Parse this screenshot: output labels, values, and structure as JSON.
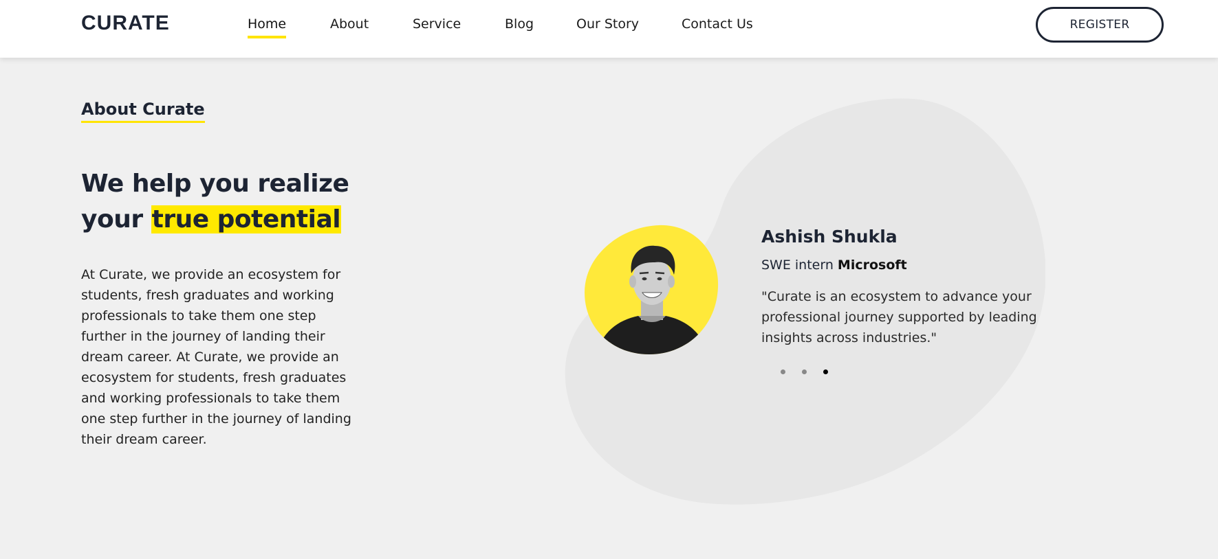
{
  "header": {
    "logo": "CURATE",
    "nav": [
      {
        "label": "Home",
        "active": true
      },
      {
        "label": "About"
      },
      {
        "label": "Service"
      },
      {
        "label": "Blog"
      },
      {
        "label": "Our Story"
      },
      {
        "label": "Contact Us"
      }
    ],
    "register_label": "REGISTER"
  },
  "about": {
    "section_label": "About Curate",
    "headline_line1": "We help you realize",
    "headline_prefix": "your ",
    "headline_highlight": "true potential",
    "body": "At Curate, we provide an ecosystem for students, fresh graduates and working professionals to take them one step further in the journey of landing their dream career. At Curate, we provide an ecosystem for students, fresh graduates and working professionals to take them one step further in the journey of landing their dream career."
  },
  "testimonial": {
    "name": "Ashish Shukla",
    "role_prefix": "SWE intern ",
    "company": "Microsoft",
    "quote": "\"Curate is an ecosystem to advance your professional journey supported by leading insights across industries.\"",
    "slides_total": 3,
    "active_slide": 3
  },
  "colors": {
    "accent": "#ffe400",
    "text_dark": "#1d2433",
    "background": "#f0f0f0",
    "blob": "#e6e6e6"
  }
}
